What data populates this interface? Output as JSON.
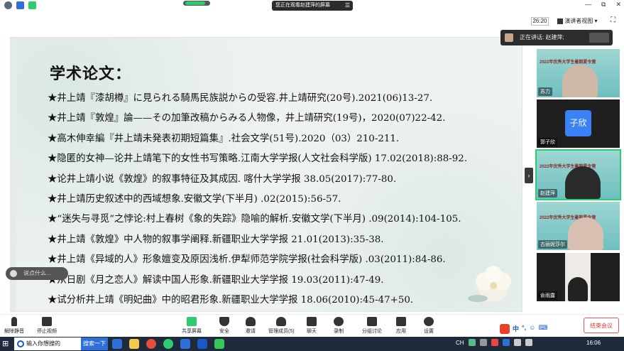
{
  "top": {
    "share_banner": "您正在观看赵建萍的屏幕",
    "share_menu": "☰",
    "timer": "26:20",
    "view_label": "演讲者视图",
    "view_chevron": "▾",
    "win_ctl_min": "—",
    "win_ctl_max": "⧉",
    "win_ctl_close": "✕",
    "fullscreen": "⛶"
  },
  "slide": {
    "title": "学术论文：",
    "references": [
      "★井上靖『漆胡樽』に見られる騎馬民族説からの受容.井上靖研究(20号).2021(06)13-27.",
      "★井上靖『敦煌』論——その加筆改稿からみる人物像，井上靖研究(19号)，2020(07)22-42.",
      "★高木伸幸編『井上靖未発表初期短篇集』.社会文学(51号).2020（03）210-211.",
      "★隐匿的女神—论井上靖笔下的女性书写策略.江南大学学报(人文社会科学版) 17.02(2018):88-92.",
      "★论井上靖小说《敦煌》的叙事特征及其成因. 喀什大学学报 38.05(2017):77-80.",
      "★井上靖历史叙述中的西域想象.安徽文学(下半月) .02(2015):56-57.",
      "★“迷失与寻觅”之悖论:村上春树《象的失踪》隐喻的解析.安徽文学(下半月) .09(2014):104-105.",
      "★井上靖《敦煌》中人物的叙事学阐释.新疆职业大学学报 21.01(2013):35-38.",
      "★井上靖《异域的人》形象嬗变及原因浅析.伊犁师范学院学报(社会科学版) .03(2011):84-86.",
      "★从日剧《月之恋人》解读中国人形象.新疆职业大学学报 19.03(2011):47-49.",
      "★试分析井上靖《明妃曲》中的昭君形象.新疆职业大学学报 18.06(2010):45-47+50."
    ],
    "comment_placeholder": "说点什么..."
  },
  "panel": {
    "speaking_label": "正在讲话: 赵建萍;",
    "tiles": [
      {
        "name": "苏力",
        "banner": "2022年优秀大学生暑期夏令营"
      },
      {
        "name": "郭子欣",
        "avatar_text": "子欣"
      },
      {
        "name": "赵建萍",
        "banner": "2022年优秀大学生暑期夏令营"
      },
      {
        "name": "古丽妮莎尔",
        "banner": "2022年优秀大学生暑期夏令营"
      },
      {
        "name": "俞雨露",
        "banner": ""
      }
    ]
  },
  "toolbar": {
    "left": [
      {
        "label": "解除静音",
        "icon": "microphone-muted-icon"
      },
      {
        "label": "停止视频",
        "icon": "video-camera-icon"
      }
    ],
    "center": [
      {
        "label": "共享屏幕",
        "icon": "share-screen-icon"
      },
      {
        "label": "安全",
        "icon": "shield-icon"
      },
      {
        "label": "邀请",
        "icon": "invite-icon"
      },
      {
        "label": "管理成员(5)",
        "icon": "participants-icon"
      },
      {
        "label": "聊天",
        "icon": "chat-icon"
      },
      {
        "label": "录制",
        "icon": "record-icon"
      },
      {
        "label": "分组讨论",
        "icon": "breakout-icon"
      },
      {
        "label": "应用",
        "icon": "apps-icon"
      },
      {
        "label": "设置",
        "icon": "gear-icon"
      }
    ],
    "end_label": "结束会议"
  },
  "taskbar": {
    "search_placeholder": "输入你想搜的",
    "search_button": "搜索一下",
    "lang": "CH",
    "time": "16:06",
    "ime_chars": [
      "中",
      "°,",
      "☺",
      "⌨"
    ]
  },
  "colors": {
    "accent_blue": "#2f6fd9",
    "record_red": "#e33333",
    "share_green": "#2ecc71"
  }
}
